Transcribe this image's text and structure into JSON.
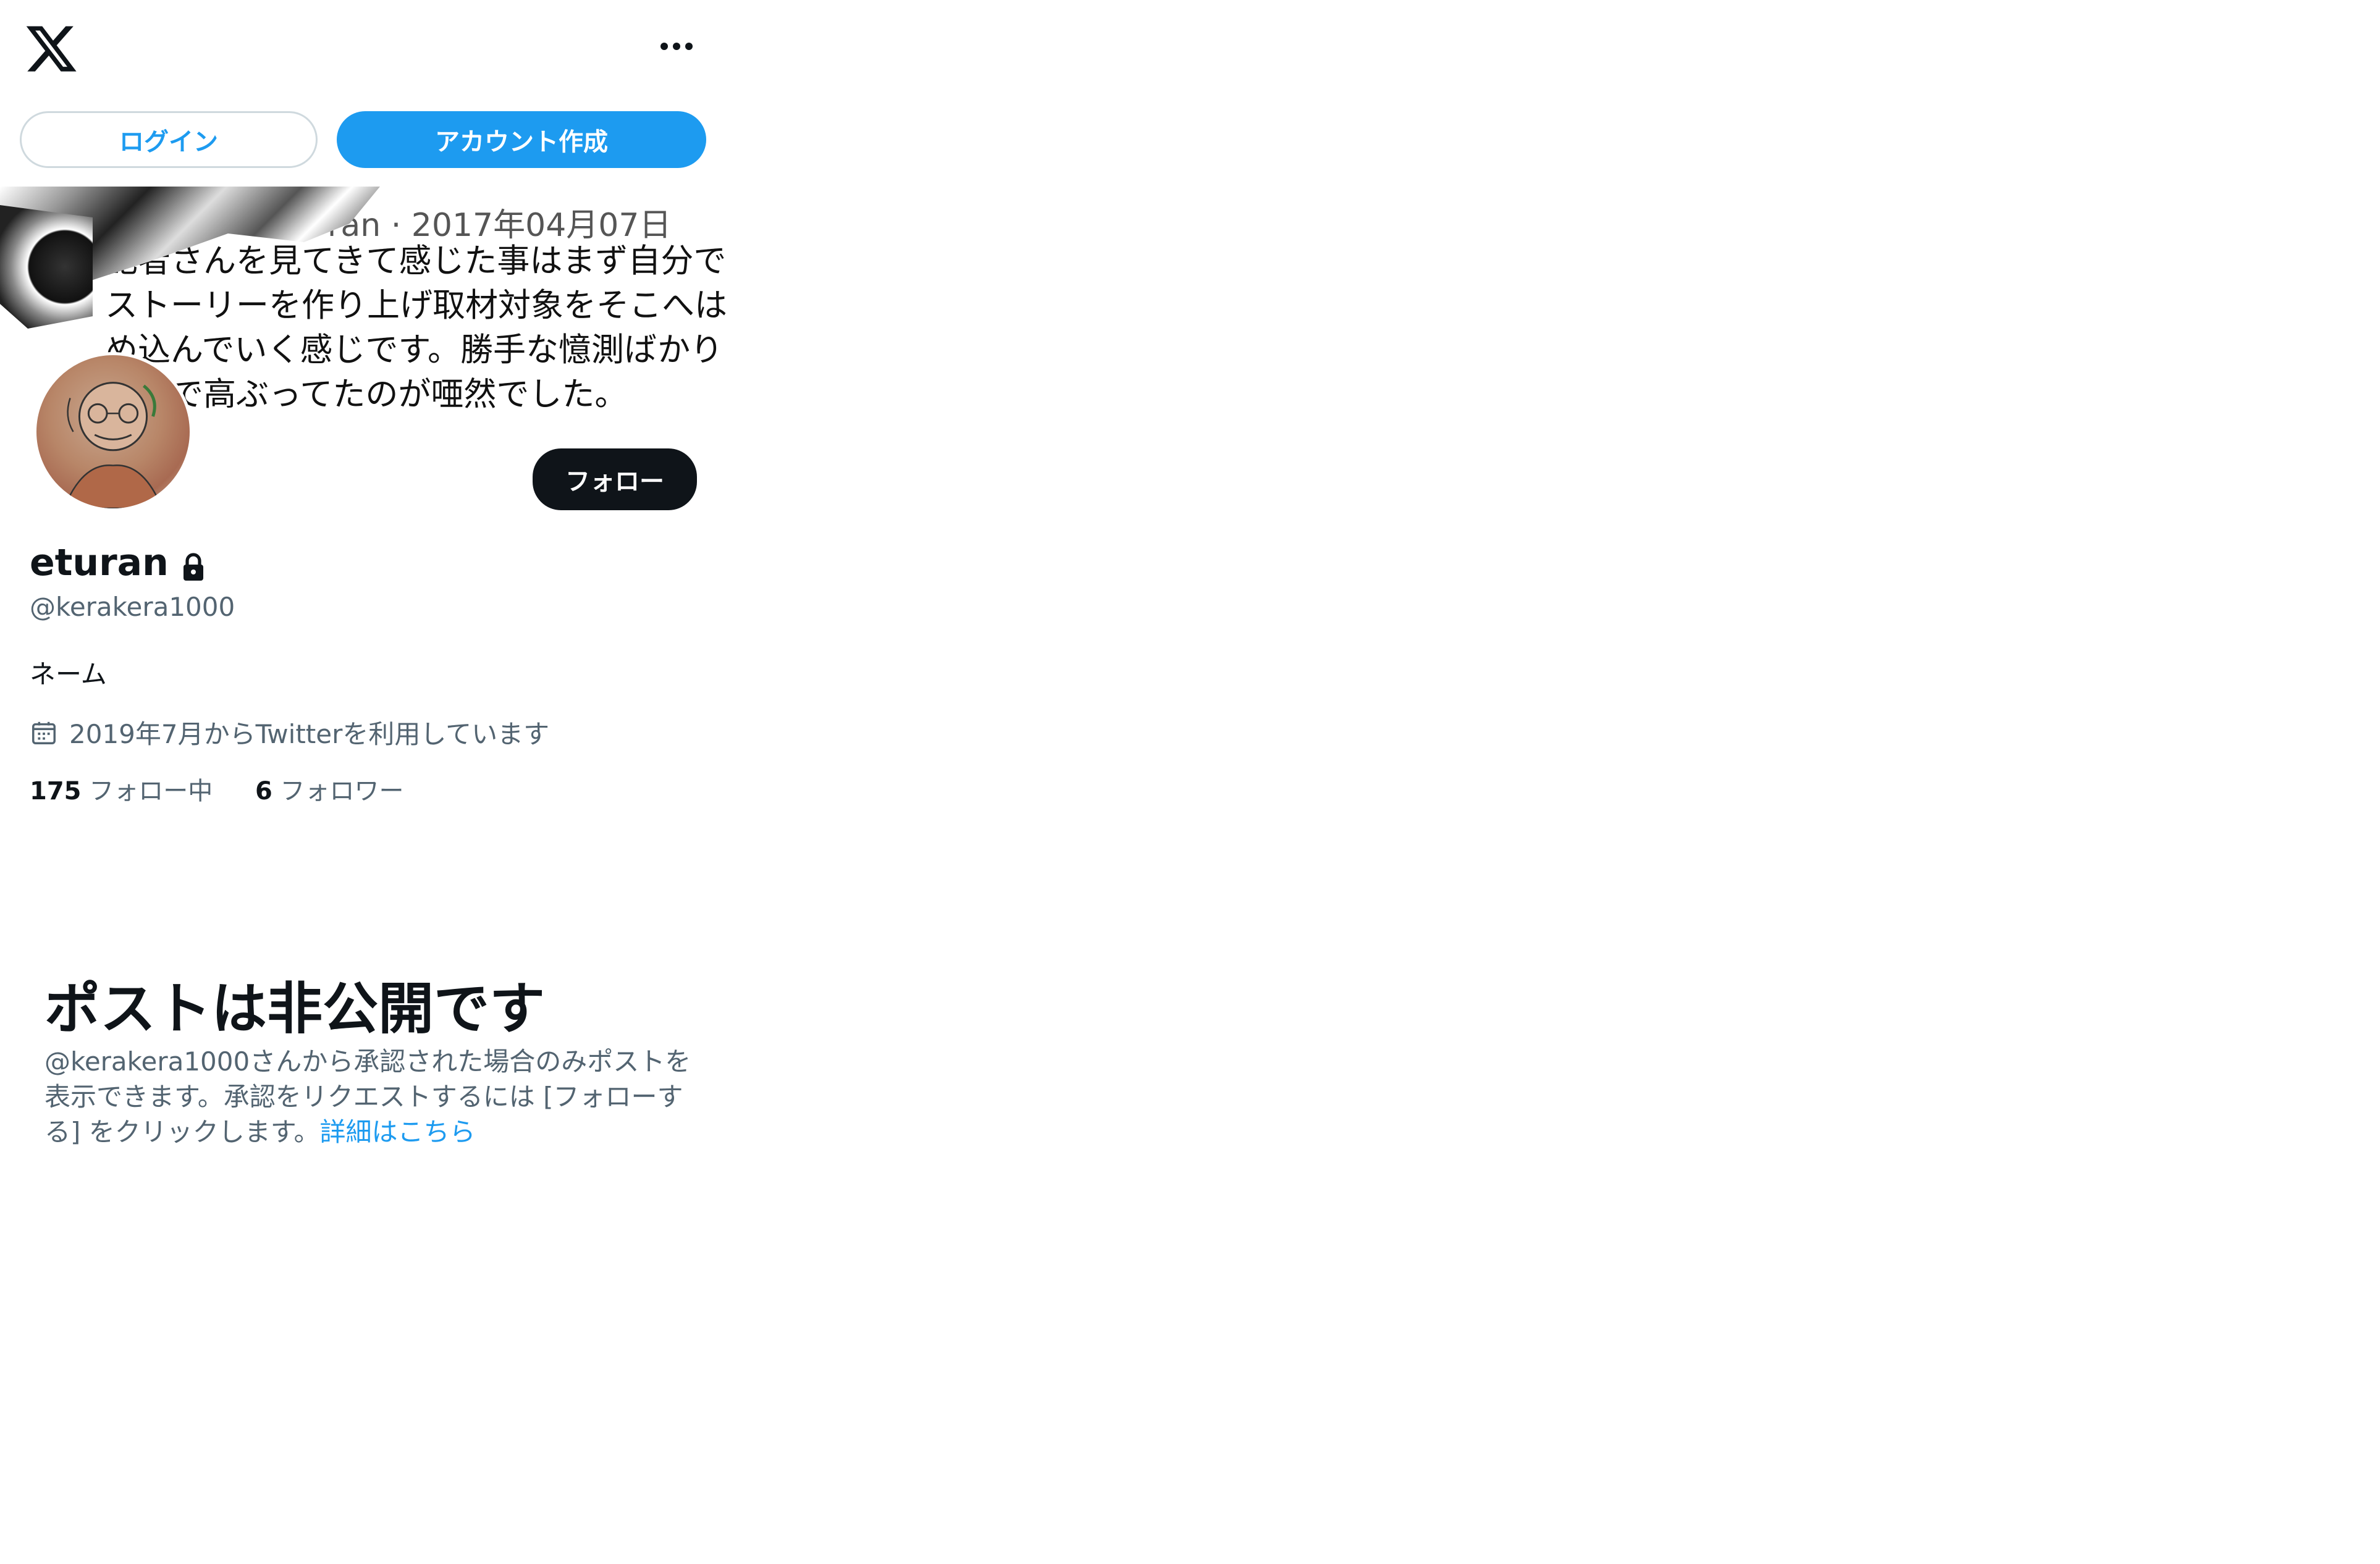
{
  "header": {
    "more_label": "…"
  },
  "auth": {
    "login_label": "ログイン",
    "signup_label": "アカウント作成"
  },
  "banner": {
    "meta": "ran · 2017年04月07日",
    "text": "記者さんを見てきて感じた事はまず自分でストーリーを作り上げ取材対象をそこへはめ込んでいく感じです。勝手な憶測ばかりなので高ぶってたのが唖然でした。"
  },
  "profile": {
    "follow_label": "フォロー",
    "display_name": "eturan",
    "handle": "@kerakera1000",
    "bio": "ネーム",
    "joined": "2019年7月からTwitterを利用しています",
    "following_count": "175",
    "following_label": "フォロー中",
    "followers_count": "6",
    "followers_label": "フォロワー"
  },
  "private_notice": {
    "title": "ポストは非公開です",
    "description": "@kerakera1000さんから承認された場合のみポストを表示できます。承認をリクエストするには [フォローする] をクリックします。",
    "learn_more": "詳細はこちら"
  },
  "icons": {
    "logo": "x-logo-icon",
    "more": "more-icon",
    "lock": "lock-icon",
    "calendar": "calendar-icon"
  },
  "colors": {
    "accent": "#1d9bf0",
    "text": "#0f1419",
    "secondary_text": "#536471",
    "border": "#cfd9de"
  }
}
